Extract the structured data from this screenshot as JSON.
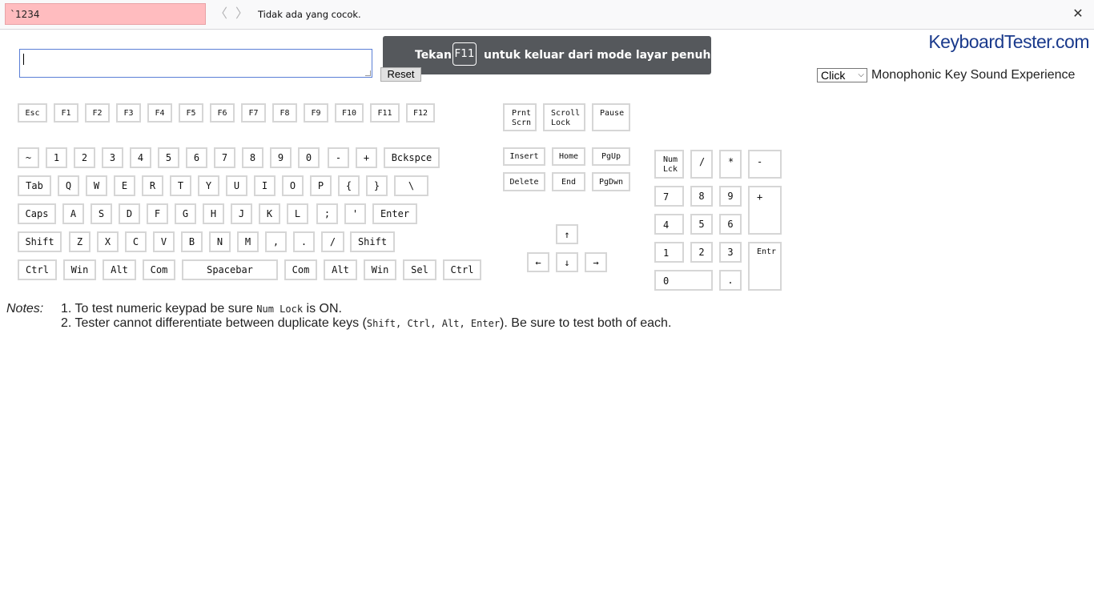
{
  "find_bar": {
    "query": "`1234",
    "prev_icon": "chevron-left-icon",
    "next_icon": "chevron-right-icon",
    "prev_glyph": "〈",
    "next_glyph": "〉",
    "status": "Tidak ada yang cocok.",
    "close_glyph": "✕"
  },
  "fullscreen_notice": {
    "before": "Tekan",
    "key": "F11",
    "after": "untuk keluar dari mode layar penuh"
  },
  "site": {
    "logo": "KeyboardTester.com"
  },
  "controls": {
    "textarea_value": "",
    "reset_label": "Reset",
    "sound_selected": "Click",
    "sound_chevron": "⌵",
    "sound_label": "Monophonic Key Sound Experience"
  },
  "keys": {
    "function_row": [
      "Esc",
      "F1",
      "F2",
      "F3",
      "F4",
      "F5",
      "F6",
      "F7",
      "F8",
      "F9",
      "F10",
      "F11",
      "F12"
    ],
    "number_row": [
      "~",
      "1",
      "2",
      "3",
      "4",
      "5",
      "6",
      "7",
      "8",
      "9",
      "0",
      "-",
      "+",
      "Bckspce"
    ],
    "qwerty_row": [
      "Tab",
      "Q",
      "W",
      "E",
      "R",
      "T",
      "Y",
      "U",
      "I",
      "O",
      "P",
      "{",
      "}",
      "\\"
    ],
    "home_row": [
      "Caps",
      "A",
      "S",
      "D",
      "F",
      "G",
      "H",
      "J",
      "K",
      "L",
      ";",
      "'",
      "Enter"
    ],
    "shift_row": [
      "Shift",
      "Z",
      "X",
      "C",
      "V",
      "B",
      "N",
      "M",
      ",",
      ".",
      "/",
      "Shift"
    ],
    "bottom_row": [
      "Ctrl",
      "Win",
      "Alt",
      "Com",
      "Spacebar",
      "Com",
      "Alt",
      "Win",
      "Sel",
      "Ctrl"
    ],
    "system": {
      "prnt_1": "Prnt",
      "prnt_2": "Scrn",
      "scroll_1": "Scroll",
      "scroll_2": "Lock",
      "pause": "Pause"
    },
    "nav": [
      "Insert",
      "Home",
      "PgUp",
      "Delete",
      "End",
      "PgDwn"
    ],
    "arrows": {
      "up": "↑",
      "left": "←",
      "down": "↓",
      "right": "→"
    },
    "numpad": {
      "numlck_1": "Num",
      "numlck_2": "Lck",
      "slash": "/",
      "star": "*",
      "minus": "-",
      "k7": "7",
      "k8": "8",
      "k9": "9",
      "plus": "+",
      "k4": "4",
      "k5": "5",
      "k6": "6",
      "k1": "1",
      "k2": "2",
      "k3": "3",
      "enter": "Entr",
      "k0": "0",
      "dot": "."
    }
  },
  "notes": {
    "label": "Notes:",
    "item1_num": "1.",
    "item1_a": "To test numeric keypad be sure ",
    "item1_code": "Num Lock",
    "item1_b": " is ON.",
    "item2_num": "2.",
    "item2_a": "Tester cannot differentiate between duplicate keys (",
    "item2_code": "Shift, Ctrl, Alt, Enter",
    "item2_b": "). Be sure to test both of each."
  }
}
